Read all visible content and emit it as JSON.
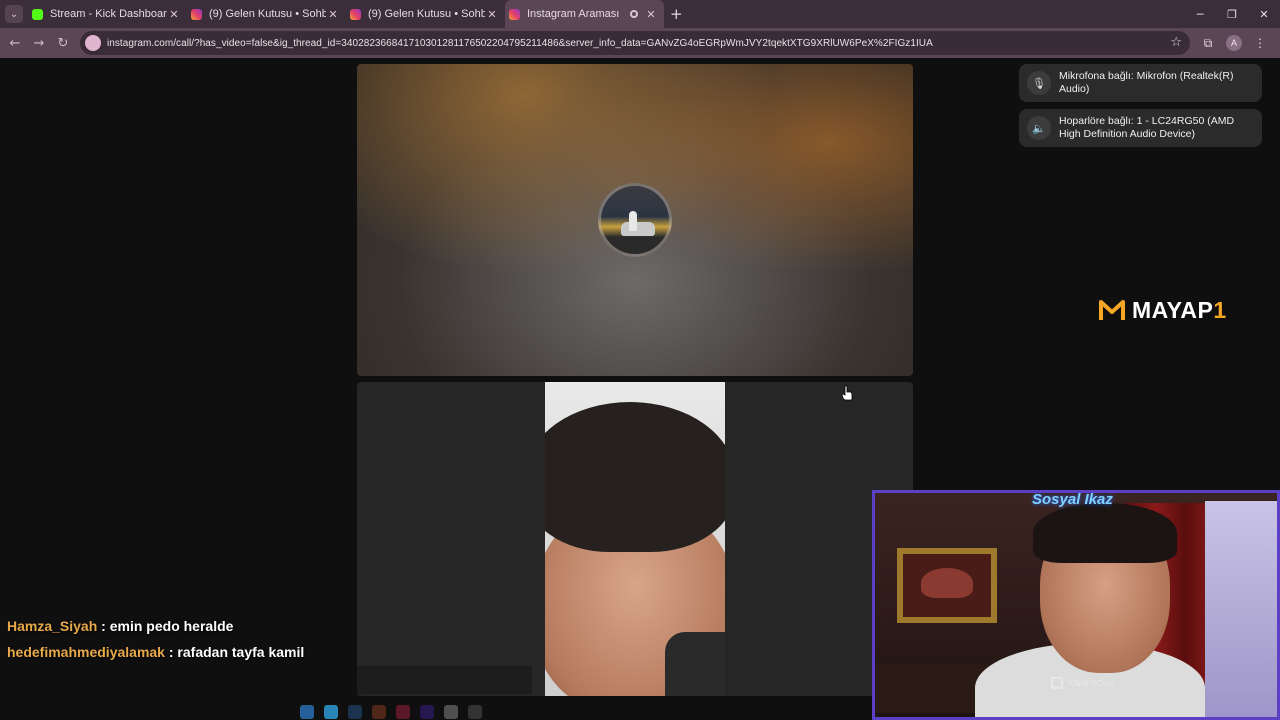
{
  "browser": {
    "tabs": [
      {
        "title": "Stream - Kick Dashboard",
        "favicon": "kick-icon",
        "active": false
      },
      {
        "title": "(9) Gelen Kutusu • Sohbetler",
        "favicon": "instagram-icon",
        "active": false
      },
      {
        "title": "(9) Gelen Kutusu • Sohbetler",
        "favicon": "instagram-icon",
        "active": false
      },
      {
        "title": "Instagram Araması",
        "favicon": "instagram-icon",
        "active": true
      }
    ],
    "url": "instagram.com/call/?has_video=false&ig_thread_id=340282366841710301281176502204795211486&server_info_data=GANvZG4oEGRpWmJVY2tqektXTG9XRlUW6PeX%2FIGz1IUA",
    "profile_initial": "A"
  },
  "devices": {
    "microphone": "Mikrofona bağlı: Mikrofon (Realtek(R) Audio)",
    "speaker": "Hoparlöre bağlı: 1 - LC24RG50 (AMD High Definition Audio Device)"
  },
  "logo": {
    "text": "MAYAP",
    "suffix": "1",
    "accent": "#f5a623"
  },
  "webcam": {
    "title": "Sosyal Ikaz",
    "watermark": "XSplit VCam"
  },
  "chat": [
    {
      "user": "Hamza_Siyah",
      "separator": " : ",
      "message": "emin pedo heralde"
    },
    {
      "user": "hedefimahmediyalamak",
      "separator": " : ",
      "message": "rafadan tayfa kamil"
    }
  ]
}
